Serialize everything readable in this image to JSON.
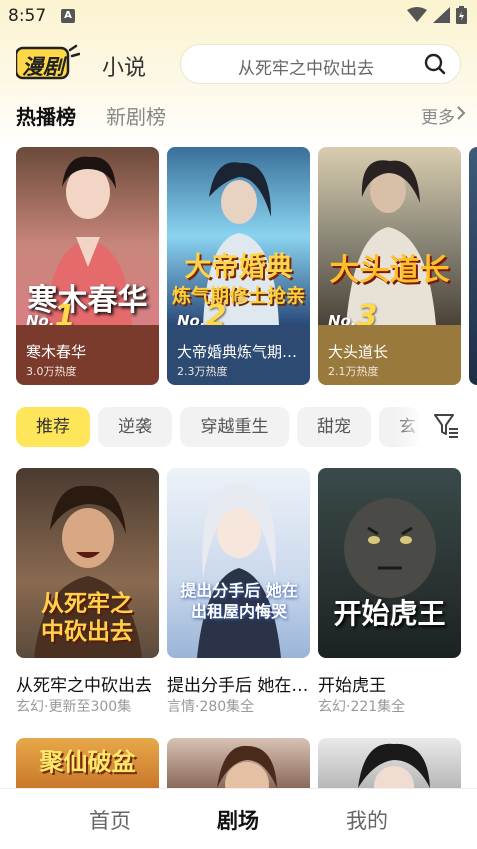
{
  "status_bar": {
    "time": "8:57",
    "notification_badge": "A"
  },
  "header": {
    "logo_text": "漫剧",
    "nav_novel": "小说",
    "search_placeholder": "从死牢之中砍出去"
  },
  "ranking": {
    "tabs": [
      {
        "label": "热播榜",
        "active": true
      },
      {
        "label": "新剧榜",
        "active": false
      }
    ],
    "more_label": "更多",
    "cards": [
      {
        "rank_prefix": "No.",
        "rank": "1",
        "cover_title": "寒木春华",
        "title": "寒木春华",
        "heat": "3.0万热度",
        "bg": "#7a3a2c"
      },
      {
        "rank_prefix": "No.",
        "rank": "2",
        "cover_title": "大帝婚典",
        "cover_subtitle": "炼气期修士抢亲",
        "title": "大帝婚典炼气期修士抢亲",
        "heat": "2.3万热度",
        "bg": "#2d4a72"
      },
      {
        "rank_prefix": "No.",
        "rank": "3",
        "cover_title": "大头道长",
        "title": "大头道长",
        "heat": "2.1万热度",
        "bg": "#9a7a3c"
      }
    ]
  },
  "genres": {
    "items": [
      {
        "label": "推荐",
        "active": true
      },
      {
        "label": "逆袭",
        "active": false
      },
      {
        "label": "穿越重生",
        "active": false
      },
      {
        "label": "甜宠",
        "active": false
      },
      {
        "label": "玄幻",
        "active": false
      }
    ]
  },
  "grid": {
    "items": [
      {
        "cover_title": "从死牢之中砍出去",
        "title": "从死牢之中砍出去",
        "meta": "玄幻·更新至300集"
      },
      {
        "cover_title": "提出分手后 她在出租屋内悔哭",
        "title": "提出分手后 她在出租屋内悔哭",
        "meta": "言情·280集全"
      },
      {
        "cover_title": "开始虎王",
        "title": "开始虎王",
        "meta": "玄幻·221集全"
      },
      {
        "cover_title": "聚仙破盆"
      }
    ]
  },
  "bottom_nav": {
    "items": [
      {
        "label": "首页",
        "active": false
      },
      {
        "label": "剧场",
        "active": true
      },
      {
        "label": "我的",
        "active": false
      }
    ]
  },
  "colors": {
    "accent_yellow": "#ffe55a",
    "chip_bg": "#f2f2f2",
    "text_primary": "#111111",
    "text_secondary": "#999999"
  }
}
